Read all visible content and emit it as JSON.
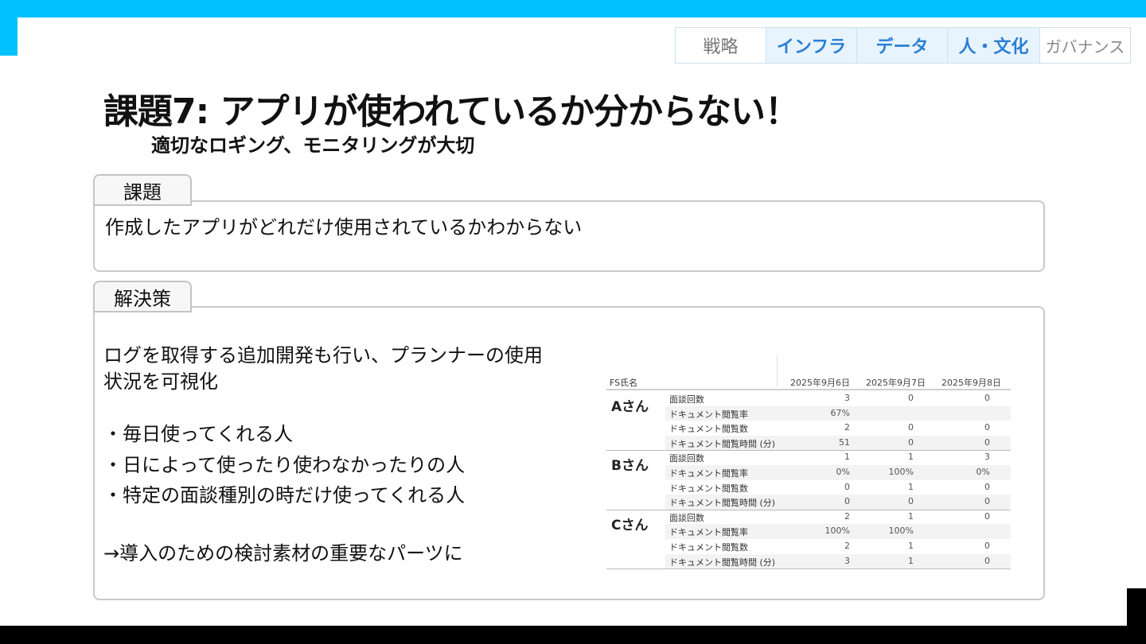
{
  "nav_tabs": [
    "戦略",
    "インフラ",
    "データ",
    "人・文化",
    "ガバナンス"
  ],
  "title": "課題7:  アプリが使われているか分からない！",
  "subtitle": "適切なロギング、モニタリングが大切",
  "issue": {
    "label": "課題",
    "text": "作成したアプリがどれだけ使用されているかわからない"
  },
  "solution": {
    "label": "解決策",
    "line1": "ログを取得する追加開発も行い、プランナーの使用",
    "line2": "状況を可視化",
    "bullets": [
      "・毎日使ってくれる人",
      "・日によって使ったり使わなかったりの人",
      "・特定の面談種別の時だけ使ってくれる人"
    ],
    "conclusion": "→導入のための検討素材の重要なパーツに"
  },
  "table": {
    "fs_header": "FS氏名",
    "dates": [
      "2025年9月6日",
      "2025年9月7日",
      "2025年9月8日"
    ],
    "groups": [
      {
        "person": "Aさん",
        "rows": [
          {
            "label": "面談回数",
            "values": [
              "3",
              "0",
              "0"
            ]
          },
          {
            "label": "ドキュメント閲覧率",
            "values": [
              "67%",
              "",
              ""
            ]
          },
          {
            "label": "ドキュメント閲覧数",
            "values": [
              "2",
              "0",
              "0"
            ]
          },
          {
            "label": "ドキュメント閲覧時間 (分)",
            "values": [
              "51",
              "0",
              "0"
            ]
          }
        ]
      },
      {
        "person": "Bさん",
        "rows": [
          {
            "label": "面談回数",
            "values": [
              "1",
              "1",
              "3"
            ]
          },
          {
            "label": "ドキュメント閲覧率",
            "values": [
              "0%",
              "100%",
              "0%"
            ]
          },
          {
            "label": "ドキュメント閲覧数",
            "values": [
              "0",
              "1",
              "0"
            ]
          },
          {
            "label": "ドキュメント閲覧時間 (分)",
            "values": [
              "0",
              "0",
              "0"
            ]
          }
        ]
      },
      {
        "person": "Cさん",
        "rows": [
          {
            "label": "面談回数",
            "values": [
              "2",
              "1",
              "0"
            ]
          },
          {
            "label": "ドキュメント閲覧率",
            "values": [
              "100%",
              "100%",
              ""
            ]
          },
          {
            "label": "ドキュメント閲覧数",
            "values": [
              "2",
              "1",
              "0"
            ]
          },
          {
            "label": "ドキュメント閲覧時間 (分)",
            "values": [
              "3",
              "1",
              "0"
            ]
          }
        ]
      }
    ]
  },
  "colors": {
    "accent": "#00c2ff",
    "active_tab_text": "#2a7fd4",
    "active_tab_bg": "#e8f4fd"
  }
}
